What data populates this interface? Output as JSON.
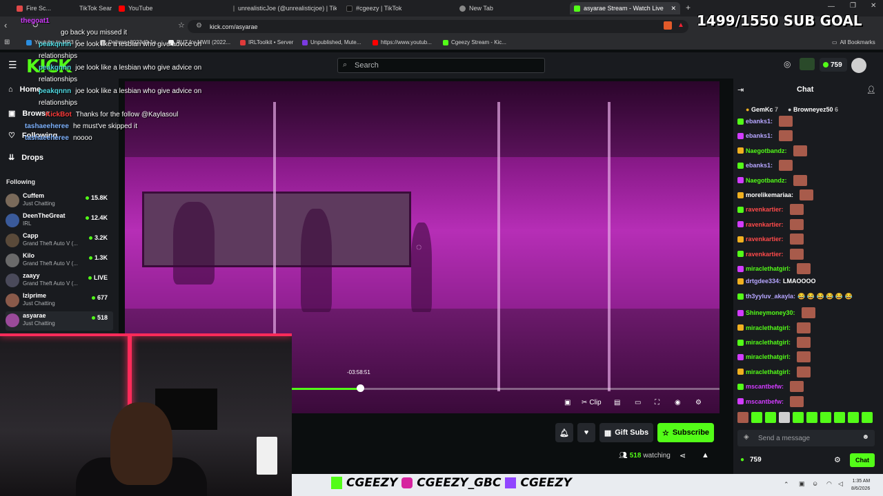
{
  "browser": {
    "tabs": [
      {
        "label": "Fire Sc...",
        "color": "#e04848"
      },
      {
        "label": "TikTok Search",
        "color": "#333"
      },
      {
        "label": "YouTube",
        "color": "#ff0000"
      },
      {
        "label": "unrealisticJoe (@unrealisticjoe) | TikT",
        "color": "#111"
      },
      {
        "label": "#cgeezy | TikTok",
        "color": "#111"
      },
      {
        "label": "New Tab",
        "color": "#888"
      },
      {
        "label": "asyarae Stream - Watch Live",
        "color": "#53fc18"
      }
    ],
    "url": "kick.com/asyarae",
    "bookmarks": [
      "Youtube to MP3 C...",
      "Delivery 8023d9-1a...",
      "RUT for MWII (2022...",
      "IRLToolkit • Server",
      "Unpublished, Mute...",
      "https://www.youtub...",
      "Cgeezy Stream - Kic..."
    ],
    "all_bookmarks": "All Bookmarks"
  },
  "header": {
    "logo": "KICK",
    "search_placeholder": "Search",
    "balance": "759"
  },
  "sidebar": {
    "nav": [
      {
        "label": "Home",
        "icon": "home-icon"
      },
      {
        "label": "Browse",
        "icon": "browse-icon"
      },
      {
        "label": "Following",
        "icon": "heart-icon"
      },
      {
        "label": "Drops",
        "icon": "drops-icon"
      }
    ],
    "following_title": "Following",
    "following": [
      {
        "name": "Cuffem",
        "category": "Just Chatting",
        "viewers": "15.8K",
        "color": "#7a6a5a"
      },
      {
        "name": "DeenTheGreat",
        "category": "IRL",
        "viewers": "12.4K",
        "color": "#3a5a9a"
      },
      {
        "name": "Capp",
        "category": "Grand Theft Auto V (...",
        "viewers": "3.2K",
        "color": "#5a4a3a"
      },
      {
        "name": "Kilo",
        "category": "Grand Theft Auto V (...",
        "viewers": "1.3K",
        "color": "#6a6a6a"
      },
      {
        "name": "zaayy",
        "category": "Grand Theft Auto V (...",
        "viewers": "LIVE",
        "color": "#4a4a5a"
      },
      {
        "name": "Iziprime",
        "category": "Just Chatting",
        "viewers": "677",
        "color": "#8a5a4a"
      },
      {
        "name": "asyarae",
        "category": "Just Chatting",
        "viewers": "518",
        "color": "#9a4a9a"
      }
    ]
  },
  "player": {
    "time_remaining": "-03:58:51",
    "progress_fraction": 0.16,
    "clip_label": "Clip"
  },
  "actions": {
    "gift_subs": "Gift Subs",
    "subscribe": "Subscribe",
    "viewers": "518",
    "watching": "watching"
  },
  "overlay": {
    "sub_goal": "1499/1550 SUB GOAL",
    "chat": [
      {
        "user": "thegoat1",
        "text": "",
        "color": "#d23cff"
      },
      {
        "user": "",
        "text": "go back you missed it",
        "color": "#d23cff"
      },
      {
        "user": "peakqnnn",
        "text": "joe look like a lesbian who give advice on relationships",
        "color": "#4fd8e0"
      },
      {
        "user": "peakqnnn",
        "text": "joe look like a lesbian who give advice on relationships",
        "color": "#4fd8e0"
      },
      {
        "user": "peakqnnn",
        "text": "joe look like a lesbian who give advice on relationships",
        "color": "#4fd8e0"
      },
      {
        "user": "KickBot",
        "text": "Thanks for the follow @Kaylasoul",
        "color": "#ff3b3b"
      },
      {
        "user": "tashaeeheree",
        "text": "he must've skipped it",
        "color": "#7fb3ff"
      },
      {
        "user": "tashaeeheree",
        "text": "noooo",
        "color": "#7fb3ff"
      }
    ]
  },
  "chat": {
    "title": "Chat",
    "pinned": [
      {
        "user": "GemKc",
        "count": "7"
      },
      {
        "user": "Browneyez50",
        "count": "6"
      }
    ],
    "messages": [
      {
        "user": "ebanks1:",
        "color": "#b6a6ff",
        "text": ""
      },
      {
        "user": "ebanks1:",
        "color": "#b6a6ff",
        "text": ""
      },
      {
        "user": "Naegotbandz:",
        "color": "#53fc18",
        "text": ""
      },
      {
        "user": "ebanks1:",
        "color": "#b6a6ff",
        "text": ""
      },
      {
        "user": "Naegotbandz:",
        "color": "#53fc18",
        "text": ""
      },
      {
        "user": "morelikemariaa:",
        "color": "#ffffff",
        "text": ""
      },
      {
        "user": "ravenkartier:",
        "color": "#ff4a4a",
        "text": ""
      },
      {
        "user": "ravenkartier:",
        "color": "#ff4a4a",
        "text": ""
      },
      {
        "user": "ravenkartier:",
        "color": "#ff4a4a",
        "text": ""
      },
      {
        "user": "ravenkartier:",
        "color": "#ff4a4a",
        "text": ""
      },
      {
        "user": "miraclethatgirl:",
        "color": "#53fc18",
        "text": ""
      },
      {
        "user": "drtgdee334:",
        "color": "#b6a6ff",
        "text": "LMAOOOO"
      },
      {
        "user": "th3yyluv_akayla:",
        "color": "#b6a6ff",
        "text": "😂 😂 😂 😂 😂 😂"
      },
      {
        "user": "Shineymoney30:",
        "color": "#53fc18",
        "text": ""
      },
      {
        "user": "miraclethatgirl:",
        "color": "#53fc18",
        "text": ""
      },
      {
        "user": "miraclethatgirl:",
        "color": "#53fc18",
        "text": ""
      },
      {
        "user": "miraclethatgirl:",
        "color": "#53fc18",
        "text": ""
      },
      {
        "user": "miraclethatgirl:",
        "color": "#53fc18",
        "text": ""
      },
      {
        "user": "mscantbefw:",
        "color": "#d23cff",
        "text": ""
      },
      {
        "user": "mscantbefw:",
        "color": "#d23cff",
        "text": ""
      }
    ],
    "input_placeholder": "Send a message",
    "balance": "759",
    "send_label": "Chat"
  },
  "taskbar": {
    "brand_items": [
      "CGEEZY",
      "CGEEZY_GBC",
      "CGEEZY"
    ],
    "time": "1:35 AM",
    "date": "8/6/2026"
  },
  "colors": {
    "accent": "#53fc18",
    "bg": "#0b0e0f",
    "panel": "#191b1f"
  }
}
